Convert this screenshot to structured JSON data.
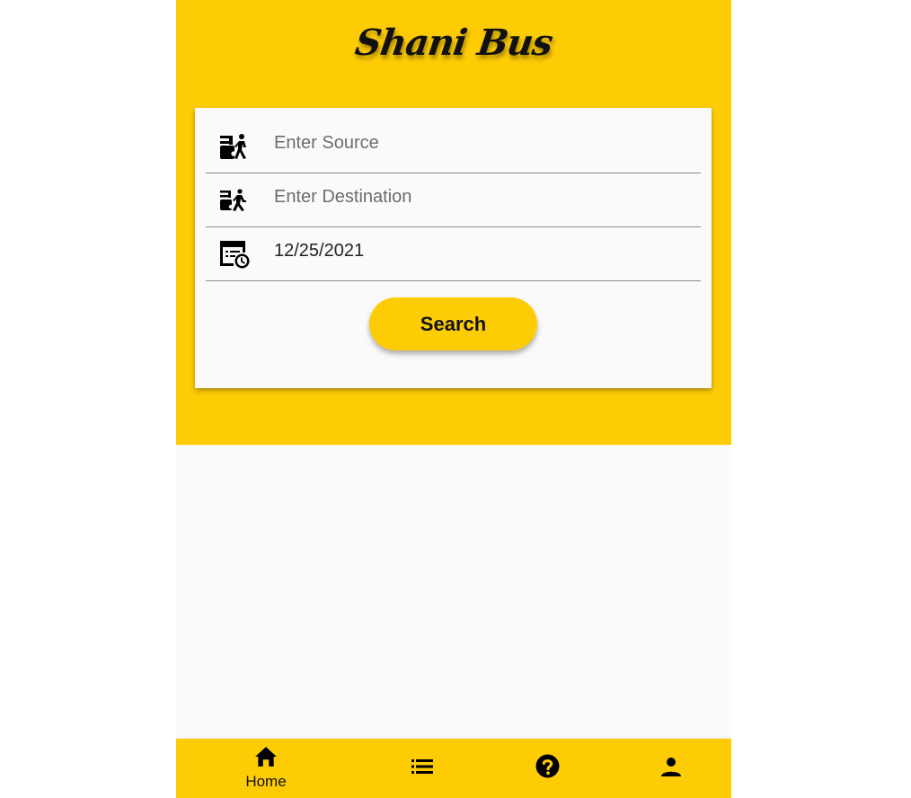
{
  "app": {
    "title": "Shani Bus",
    "brand_color": "#fecc05"
  },
  "search_form": {
    "source": {
      "icon": "bus-boarding-icon",
      "placeholder": "Enter Source",
      "value": ""
    },
    "destination": {
      "icon": "bus-alight-icon",
      "placeholder": "Enter Destination",
      "value": ""
    },
    "date": {
      "icon": "calendar-clock-icon",
      "placeholder": "",
      "value": "12/25/2021"
    },
    "search_label": "Search"
  },
  "bottom_nav": {
    "items": [
      {
        "icon": "home-icon",
        "label": "Home",
        "active": true
      },
      {
        "icon": "list-icon",
        "label": "",
        "active": false
      },
      {
        "icon": "help-icon",
        "label": "",
        "active": false
      },
      {
        "icon": "person-icon",
        "label": "",
        "active": false
      }
    ]
  }
}
